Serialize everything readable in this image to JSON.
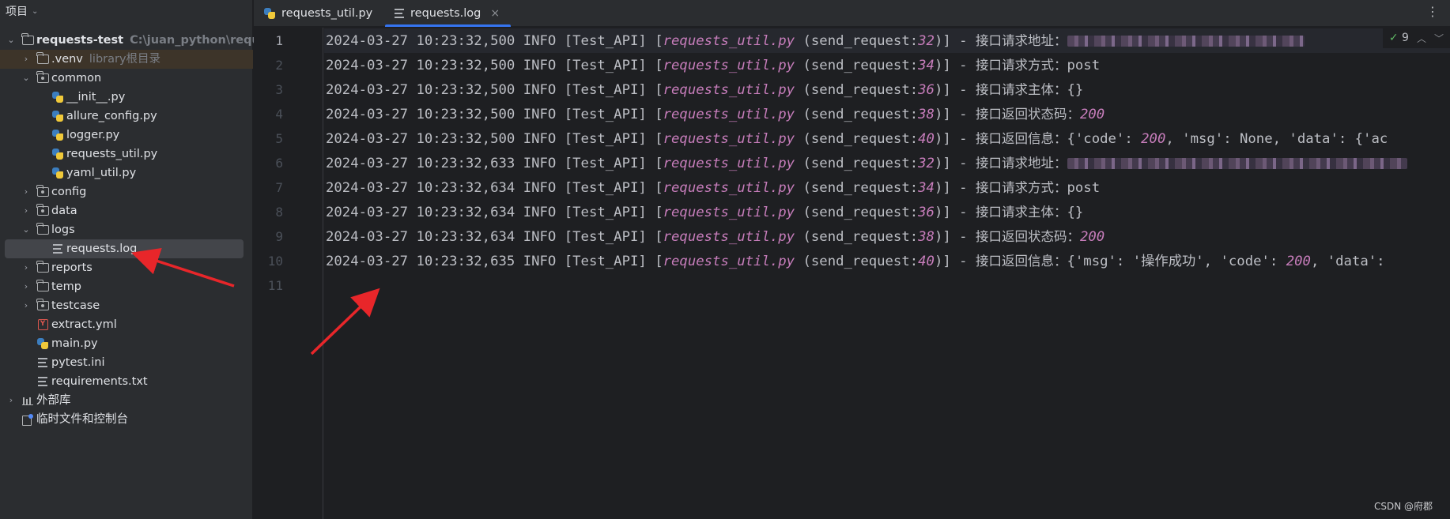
{
  "panel": {
    "title": "项目"
  },
  "tree": [
    {
      "label": "requests-test",
      "sub": "C:\\juan_python\\requests-te",
      "bold": true,
      "icon": "folder-icon",
      "arrow": "v"
    },
    {
      "label": ".venv",
      "sub": "library根目录",
      "icon": "folder-icon",
      "arrow": ">"
    },
    {
      "label": "common",
      "icon": "package-folder-icon",
      "arrow": "v"
    },
    {
      "label": "__init__.py",
      "icon": "python-file-icon"
    },
    {
      "label": "allure_config.py",
      "icon": "python-file-icon"
    },
    {
      "label": "logger.py",
      "icon": "python-file-icon"
    },
    {
      "label": "requests_util.py",
      "icon": "python-file-icon"
    },
    {
      "label": "yaml_util.py",
      "icon": "python-file-icon"
    },
    {
      "label": "config",
      "icon": "package-folder-icon",
      "arrow": ">"
    },
    {
      "label": "data",
      "icon": "package-folder-icon",
      "arrow": ">"
    },
    {
      "label": "logs",
      "icon": "folder-icon",
      "arrow": "v"
    },
    {
      "label": "requests.log",
      "icon": "text-file-icon"
    },
    {
      "label": "reports",
      "icon": "folder-icon",
      "arrow": ">"
    },
    {
      "label": "temp",
      "icon": "folder-icon",
      "arrow": ">"
    },
    {
      "label": "testcase",
      "icon": "package-folder-icon",
      "arrow": ">"
    },
    {
      "label": "extract.yml",
      "icon": "yaml-file-icon"
    },
    {
      "label": "main.py",
      "icon": "python-file-icon"
    },
    {
      "label": "pytest.ini",
      "icon": "text-file-icon"
    },
    {
      "label": "requirements.txt",
      "icon": "text-file-icon"
    },
    {
      "label": "外部库",
      "icon": "library-icon",
      "arrow": ">"
    },
    {
      "label": "临时文件和控制台",
      "icon": "scratch-icon"
    }
  ],
  "tabs": [
    {
      "label": "requests_util.py",
      "icon": "python-file-icon"
    },
    {
      "label": "requests.log",
      "icon": "text-file-icon",
      "close": "×"
    }
  ],
  "inspection": {
    "check": "✓",
    "count": "9"
  },
  "log": {
    "common": {
      "timestamp_prefix": "2024-03-27 10:23:32,",
      "level": "INFO",
      "logger": "[Test_API]",
      "file": "requests_util.py",
      "func": "send_request:"
    },
    "lines": [
      {
        "n": "1",
        "ms": "500",
        "lineno": "32",
        "msg": "接口请求地址：",
        "tail": ""
      },
      {
        "n": "2",
        "ms": "500",
        "lineno": "34",
        "msg": "接口请求方式：",
        "tail": "post"
      },
      {
        "n": "3",
        "ms": "500",
        "lineno": "36",
        "msg": "接口请求主体：",
        "tail": "{}"
      },
      {
        "n": "4",
        "ms": "500",
        "lineno": "38",
        "msg": "接口返回状态码：",
        "tail": "",
        "num": "200"
      },
      {
        "n": "5",
        "ms": "500",
        "lineno": "40",
        "msg": "接口返回信息：",
        "tail": "{'code': ",
        "num": "200",
        "tail2": ", 'msg': None, 'data': {'ac"
      },
      {
        "n": "6",
        "ms": "633",
        "lineno": "32",
        "msg": "接口请求地址：",
        "tail": ""
      },
      {
        "n": "7",
        "ms": "634",
        "lineno": "34",
        "msg": "接口请求方式：",
        "tail": "post"
      },
      {
        "n": "8",
        "ms": "634",
        "lineno": "36",
        "msg": "接口请求主体：",
        "tail": "{}"
      },
      {
        "n": "9",
        "ms": "634",
        "lineno": "38",
        "msg": "接口返回状态码：",
        "tail": "",
        "num": "200"
      },
      {
        "n": "10",
        "ms": "635",
        "lineno": "40",
        "msg": "接口返回信息：",
        "tail": "{'msg': '操作成功', 'code': ",
        "num": "200",
        "tail2": ", 'data':"
      },
      {
        "n": "11"
      }
    ]
  },
  "watermark": "CSDN @府郡",
  "colors": {
    "accent": "#3574f0",
    "arrow_annotation": "#e8262a",
    "italic_purple": "#c77dbb"
  }
}
